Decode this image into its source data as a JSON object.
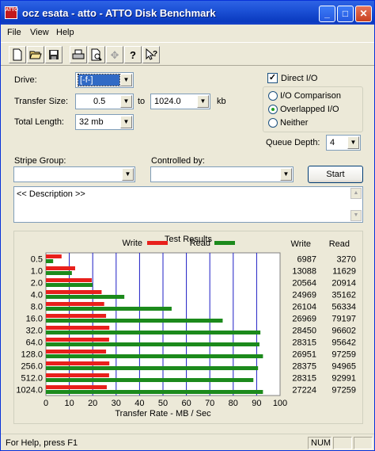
{
  "window": {
    "title": "ocz esata - atto - ATTO Disk Benchmark",
    "icon_text": "ATTO",
    "buttons": {
      "minimize": "_",
      "maximize": "□",
      "close": "✕"
    }
  },
  "menu": {
    "items": [
      {
        "label": "File"
      },
      {
        "label": "View"
      },
      {
        "label": "Help"
      }
    ]
  },
  "toolbar": {
    "icons": [
      "new-icon",
      "open-icon",
      "save-icon",
      "print-icon",
      "print-preview-icon",
      "move-icon",
      "help-icon",
      "context-help-icon"
    ]
  },
  "settings": {
    "drive_label": "Drive:",
    "drive_value": "[-f-]",
    "transfer_size_label": "Transfer Size:",
    "transfer_from": "0.5",
    "transfer_to_label": "to",
    "transfer_to": "1024.0",
    "transfer_unit": "kb",
    "total_length_label": "Total Length:",
    "total_length": "32 mb",
    "direct_io_label": "Direct I/O",
    "direct_io_checked": true,
    "io_comparison_label": "I/O Comparison",
    "overlapped_io_label": "Overlapped I/O",
    "neither_label": "Neither",
    "selected_mode": "overlapped",
    "queue_depth_label": "Queue Depth:",
    "queue_depth": "4",
    "stripe_group_label": "Stripe Group:",
    "stripe_group": "",
    "controlled_by_label": "Controlled by:",
    "controlled_by": "",
    "start_label": "Start"
  },
  "description": {
    "text": "<< Description >>"
  },
  "chart_data": {
    "type": "bar",
    "title": "Test Results",
    "xlabel": "Transfer Rate - MB / Sec",
    "xlim": [
      0,
      100
    ],
    "x_ticks": [
      "0",
      "10",
      "20",
      "30",
      "40",
      "50",
      "60",
      "70",
      "80",
      "90",
      "100"
    ],
    "categories": [
      "0.5",
      "1.0",
      "2.0",
      "4.0",
      "8.0",
      "16.0",
      "32.0",
      "64.0",
      "128.0",
      "256.0",
      "512.0",
      "1024.0"
    ],
    "series": [
      {
        "name": "Write",
        "color": "#E8201C",
        "values": [
          6.7,
          12.5,
          19.6,
          23.8,
          24.9,
          25.7,
          27.1,
          27.0,
          25.7,
          27.1,
          27.0,
          26.0
        ]
      },
      {
        "name": "Read",
        "color": "#1C8A1C",
        "values": [
          3.1,
          11.1,
          19.9,
          33.5,
          53.7,
          75.5,
          91.6,
          91.2,
          92.7,
          90.6,
          88.6,
          92.7
        ]
      }
    ],
    "table_headers": {
      "write": "Write",
      "read": "Read"
    },
    "table": [
      {
        "write": "6987",
        "read": "3270"
      },
      {
        "write": "13088",
        "read": "11629"
      },
      {
        "write": "20564",
        "read": "20914"
      },
      {
        "write": "24969",
        "read": "35162"
      },
      {
        "write": "26104",
        "read": "56334"
      },
      {
        "write": "26969",
        "read": "79197"
      },
      {
        "write": "28450",
        "read": "96602"
      },
      {
        "write": "28315",
        "read": "95642"
      },
      {
        "write": "26951",
        "read": "97259"
      },
      {
        "write": "28375",
        "read": "94965"
      },
      {
        "write": "28315",
        "read": "92991"
      },
      {
        "write": "27224",
        "read": "97259"
      }
    ]
  },
  "status": {
    "help_text": "For Help, press F1",
    "num_indicator": "NUM"
  }
}
